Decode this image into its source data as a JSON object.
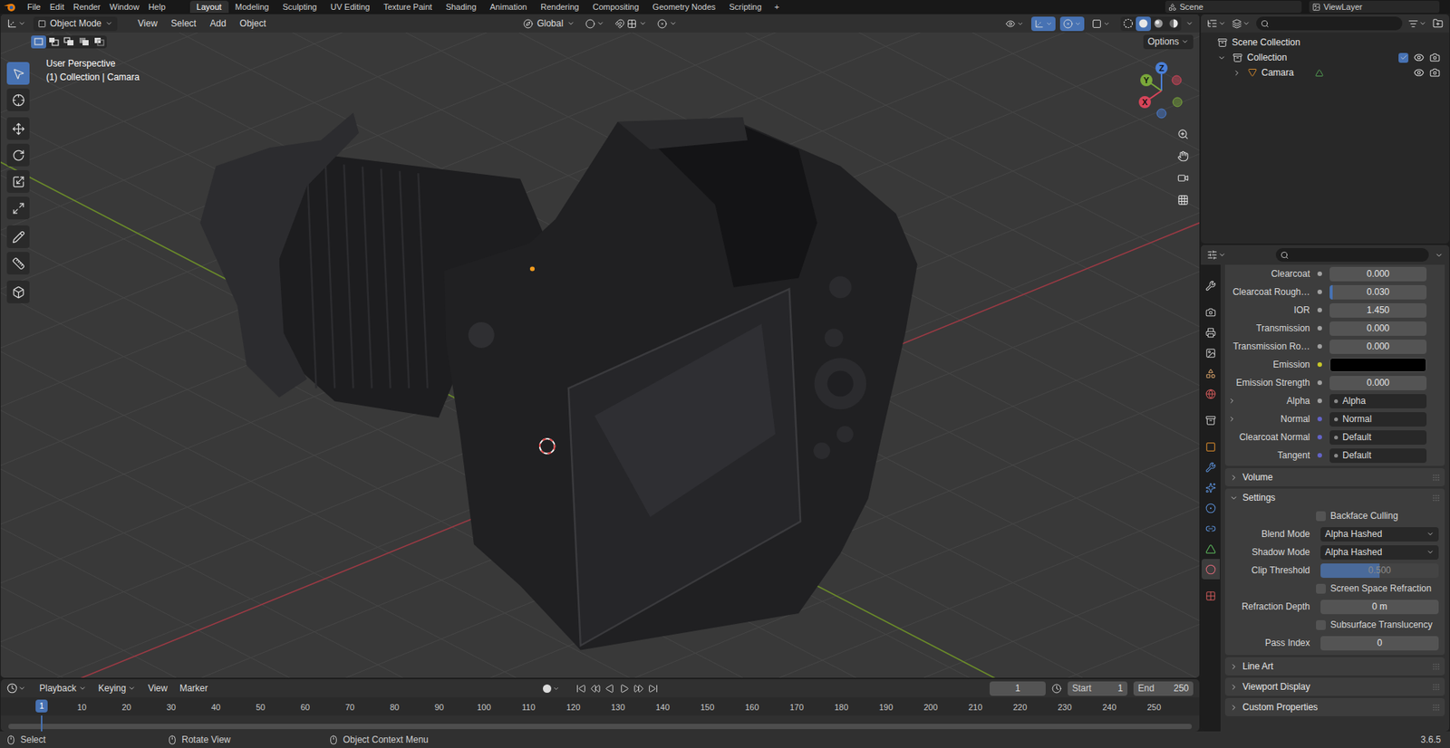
{
  "top_bar": {
    "menus": [
      "File",
      "Edit",
      "Render",
      "Window",
      "Help"
    ],
    "workspaces": [
      {
        "label": "Layout",
        "selected": true
      },
      {
        "label": "Modeling",
        "selected": false
      },
      {
        "label": "Sculpting",
        "selected": false
      },
      {
        "label": "UV Editing",
        "selected": false
      },
      {
        "label": "Texture Paint",
        "selected": false
      },
      {
        "label": "Shading",
        "selected": false
      },
      {
        "label": "Animation",
        "selected": false
      },
      {
        "label": "Rendering",
        "selected": false
      },
      {
        "label": "Compositing",
        "selected": false
      },
      {
        "label": "Geometry Nodes",
        "selected": false
      },
      {
        "label": "Scripting",
        "selected": false
      }
    ],
    "add_workspace": "+",
    "scene": "Scene",
    "view_layer": "ViewLayer"
  },
  "viewport": {
    "mode": "Object Mode",
    "menus": [
      "View",
      "Select",
      "Add",
      "Object"
    ],
    "orientation": "Global",
    "options": "Options",
    "select_modes": [
      {
        "selected": true
      },
      {
        "selected": false
      },
      {
        "selected": false
      },
      {
        "selected": false
      },
      {
        "selected": false
      }
    ],
    "header_toggles": [
      {
        "selected": false
      },
      {
        "selected": true
      },
      {
        "selected": true
      },
      {
        "selected": false
      }
    ],
    "shading": [
      {
        "selected": false
      },
      {
        "selected": true
      },
      {
        "selected": false
      },
      {
        "selected": false
      }
    ],
    "info": [
      "User Perspective",
      "(1) Collection | Camara"
    ],
    "tools": [
      {
        "selected": true
      },
      {
        "selected": false
      },
      {
        "selected": false
      },
      {
        "selected": false
      },
      {
        "selected": false
      },
      {
        "selected": false
      },
      {
        "selected": false
      },
      {
        "selected": false
      },
      {
        "selected": false
      }
    ],
    "axes": [
      {
        "label": "Z",
        "color": "#4a7fd6"
      },
      {
        "label": "Y",
        "color": "#7aa83a"
      },
      {
        "label": "X",
        "color": "#d6455a"
      }
    ]
  },
  "outliner": {
    "root": {
      "label": "Scene Collection",
      "children": [
        {
          "label": "Collection",
          "expanded": true,
          "checked": true,
          "visible": true,
          "renderable": true,
          "children": [
            {
              "label": "Camara",
              "expanded": false,
              "visible": true,
              "renderable": true,
              "children": []
            }
          ]
        }
      ]
    }
  },
  "properties": {
    "tabs": [
      {
        "selected": false
      },
      {
        "selected": false
      },
      {
        "selected": false
      },
      {
        "selected": false
      },
      {
        "selected": false
      },
      {
        "selected": false
      },
      {
        "selected": false
      },
      {
        "selected": false
      },
      {
        "selected": false
      },
      {
        "selected": false
      },
      {
        "selected": false
      },
      {
        "selected": false
      },
      {
        "selected": false
      },
      {
        "selected": true
      },
      {
        "selected": false
      }
    ],
    "rows": [
      {
        "kind": "slider",
        "label": "Clearcoat",
        "value": "0.000",
        "level": 0,
        "socket": "#a1a1a1",
        "expandable": false
      },
      {
        "kind": "slider",
        "label": "Clearcoat Rough…",
        "value": "0.030",
        "level": 0.03,
        "socket": "#a1a1a1",
        "expandable": false
      },
      {
        "kind": "number",
        "label": "IOR",
        "value": "1.450",
        "socket": "#a1a1a1",
        "expandable": false
      },
      {
        "kind": "slider",
        "label": "Transmission",
        "value": "0.000",
        "level": 0,
        "socket": "#a1a1a1",
        "expandable": false
      },
      {
        "kind": "slider",
        "label": "Transmission Ro…",
        "value": "0.000",
        "level": 0,
        "socket": "#a1a1a1",
        "expandable": false
      },
      {
        "kind": "color",
        "label": "Emission",
        "color": "#000000",
        "socket": "#c7c729",
        "expandable": false
      },
      {
        "kind": "number",
        "label": "Emission Strength",
        "value": "0.000",
        "socket": "#a1a1a1",
        "expandable": false
      },
      {
        "kind": "link",
        "label": "Alpha",
        "value": "Alpha",
        "socket": "#a1a1a1",
        "expandable": true
      },
      {
        "kind": "link",
        "label": "Normal",
        "value": "Normal",
        "socket": "#6363c7",
        "expandable": true
      },
      {
        "kind": "link",
        "label": "Clearcoat Normal",
        "value": "Default",
        "socket": "#6363c7",
        "expandable": false
      },
      {
        "kind": "link",
        "label": "Tangent",
        "value": "Default",
        "socket": "#6363c7",
        "expandable": false
      }
    ],
    "panels": [
      {
        "label": "Volume",
        "expanded": false,
        "rows": []
      },
      {
        "label": "Settings",
        "expanded": true,
        "rows": [
          {
            "kind": "checkbox",
            "label": "Backface Culling",
            "checked": false
          },
          {
            "kind": "dropdown",
            "label": "Blend Mode",
            "value": "Alpha Hashed"
          },
          {
            "kind": "dropdown",
            "label": "Shadow Mode",
            "value": "Alpha Hashed"
          },
          {
            "kind": "slider",
            "label": "Clip Threshold",
            "value": "0.500",
            "level": 0.5,
            "disabled": true
          },
          {
            "kind": "checkbox",
            "label": "Screen Space Refraction",
            "checked": false
          },
          {
            "kind": "number",
            "label": "Refraction Depth",
            "value": "0 m",
            "disabled": false
          },
          {
            "kind": "checkbox",
            "label": "Subsurface Translucency",
            "checked": false
          },
          {
            "kind": "number",
            "label": "Pass Index",
            "value": "0",
            "disabled": false
          }
        ]
      },
      {
        "label": "Line Art",
        "expanded": false,
        "rows": []
      },
      {
        "label": "Viewport Display",
        "expanded": false,
        "rows": []
      },
      {
        "label": "Custom Properties",
        "expanded": false,
        "rows": []
      }
    ]
  },
  "timeline": {
    "menus": [
      "Playback",
      "Keying",
      "View",
      "Marker"
    ],
    "current_frame": "1",
    "start_label": "Start",
    "start": "1",
    "end_label": "End",
    "end": "250",
    "playhead": "1",
    "ticks": [
      "10",
      "20",
      "30",
      "40",
      "50",
      "60",
      "70",
      "80",
      "90",
      "100",
      "110",
      "120",
      "130",
      "140",
      "150",
      "160",
      "170",
      "180",
      "190",
      "200",
      "210",
      "220",
      "230",
      "240",
      "250"
    ]
  },
  "status_bar": {
    "hints": [
      "Select",
      "Rotate View",
      "Object Context Menu"
    ],
    "version": "3.6.5"
  }
}
